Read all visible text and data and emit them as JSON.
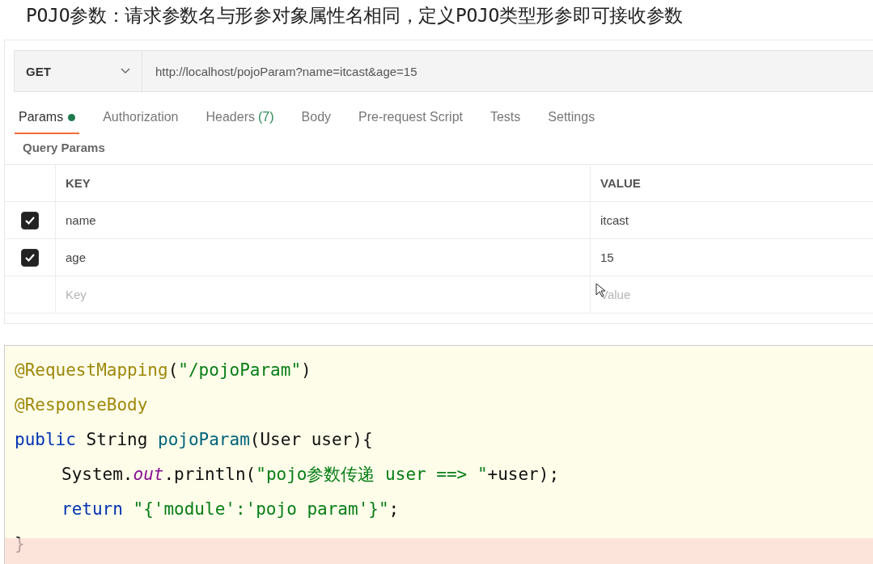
{
  "heading": "POJO参数：请求参数名与形参对象属性名相同，定义POJO类型形参即可接收参数",
  "request": {
    "method": "GET",
    "url": "http://localhost/pojoParam?name=itcast&age=15"
  },
  "tabs": [
    {
      "label": "Params",
      "selected": true,
      "dot": true
    },
    {
      "label": "Authorization",
      "selected": false
    },
    {
      "label": "Headers",
      "count": "(7)",
      "selected": false
    },
    {
      "label": "Body",
      "selected": false
    },
    {
      "label": "Pre-request Script",
      "selected": false
    },
    {
      "label": "Tests",
      "selected": false
    },
    {
      "label": "Settings",
      "selected": false
    }
  ],
  "section_title": "Query Params",
  "table": {
    "columns": [
      "KEY",
      "VALUE"
    ],
    "rows": [
      {
        "key": "name",
        "value": "itcast",
        "checked": true
      },
      {
        "key": "age",
        "value": "15",
        "checked": true
      }
    ],
    "new_row": {
      "key_placeholder": "Key",
      "value_placeholder": "Value"
    }
  },
  "code_lines": [
    {
      "tokens": [
        {
          "kind": "annotation",
          "text": "@RequestMapping"
        },
        {
          "kind": "plain",
          "text": "("
        },
        {
          "kind": "string",
          "text": "\"/pojoParam\""
        },
        {
          "kind": "plain",
          "text": ")"
        }
      ]
    },
    {
      "tokens": [
        {
          "kind": "annotation",
          "text": "@ResponseBody"
        }
      ]
    },
    {
      "tokens": [
        {
          "kind": "keyword",
          "text": "public"
        },
        {
          "kind": "plain",
          "text": " String "
        },
        {
          "kind": "method",
          "text": "pojoParam"
        },
        {
          "kind": "plain",
          "text": "(User user){"
        }
      ],
      "children": [
        {
          "tokens": [
            {
              "kind": "plain",
              "text": "System."
            },
            {
              "kind": "static",
              "text": "out"
            },
            {
              "kind": "plain",
              "text": ".println("
            },
            {
              "kind": "string",
              "text": "\"pojo参数传递 user ==> \""
            },
            {
              "kind": "plain",
              "text": "+user);"
            }
          ]
        },
        {
          "tokens": [
            {
              "kind": "keyword",
              "text": "return"
            },
            {
              "kind": "string",
              "text": " \"{'module':'pojo param'}\""
            },
            {
              "kind": "plain",
              "text": ";"
            }
          ]
        }
      ]
    },
    {
      "tokens": [
        {
          "kind": "plain",
          "text": "}"
        }
      ]
    }
  ]
}
